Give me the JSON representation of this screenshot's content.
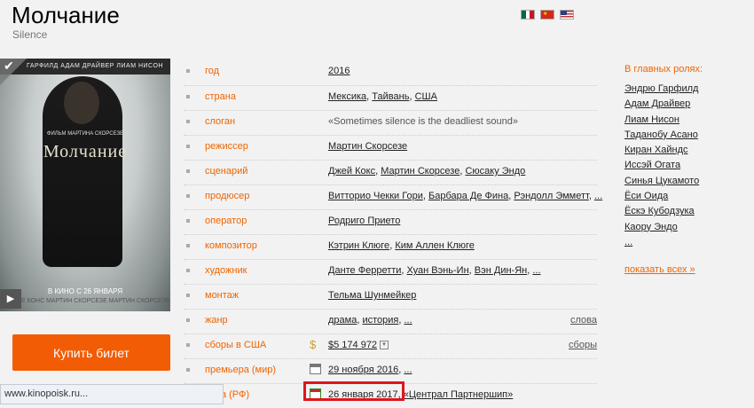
{
  "page": {
    "title": "Молчание",
    "original_title": "Silence"
  },
  "flags": [
    {
      "country": "Мексика",
      "colors": [
        "#006847",
        "#ffffff",
        "#ce1126"
      ]
    },
    {
      "country": "Тайвань",
      "colors": [
        "#d62918"
      ]
    },
    {
      "country": "США",
      "colors": [
        "#2c3e87",
        "#c0392b",
        "#ffffff"
      ]
    }
  ],
  "poster": {
    "top_text": "ГАРФИЛД   АДАМ ДРАЙВЕР   ЛИАМ НИСОН",
    "director_line": "ФИЛЬМ МАРТИНА СКОРСЕЗЕ",
    "movie_title": "Молчание",
    "release_line": "В КИНО С 26 ЯНВАРЯ",
    "credits_line": "НАЙКЛЕ КОНС  МАРТИН СКОРСЕЗЕ  МАРТИН СКОРСЕЗЕ"
  },
  "buy_ticket_label": "Купить билет",
  "status_bar": "www.kinopoisk.ru...",
  "info": {
    "year": {
      "label": "год",
      "value": "2016"
    },
    "country": {
      "label": "страна",
      "values": [
        "Мексика",
        "Тайвань",
        "США"
      ]
    },
    "slogan": {
      "label": "слоган",
      "value": "«Sometimes silence is the deadliest sound»"
    },
    "director": {
      "label": "режиссер",
      "value": "Мартин Скорсезе"
    },
    "writer": {
      "label": "сценарий",
      "values": [
        "Джей Кокс",
        "Мартин Скорсезе",
        "Сюсаку Эндо"
      ]
    },
    "producer": {
      "label": "продюсер",
      "values": [
        "Витторио Чекки Гори",
        "Барбара Де Фина",
        "Рэндолл Эмметт"
      ],
      "more": "..."
    },
    "operator": {
      "label": "оператор",
      "value": "Родриго Прието"
    },
    "composer": {
      "label": "композитор",
      "values": [
        "Кэтрин Клюге",
        "Ким Аллен Клюге"
      ]
    },
    "artist": {
      "label": "художник",
      "values": [
        "Данте Ферретти",
        "Хуан Вэнь-Ин",
        "Вэн Дин-Ян"
      ],
      "more": "..."
    },
    "editing": {
      "label": "монтаж",
      "value": "Тельма Шунмейкер"
    },
    "genre": {
      "label": "жанр",
      "values": [
        "драма",
        "история"
      ],
      "more": "...",
      "right_link": "слова"
    },
    "box_office_us": {
      "label": "сборы в США",
      "value": "$5 174 972",
      "right_link": "сборы"
    },
    "premiere_world": {
      "label": "премьера (мир)",
      "value": "29 ноября 2016",
      "more": "..."
    },
    "premiere_rf": {
      "label": "премьера (РФ)",
      "label_visible": "ьера (РФ)",
      "value": "26 января 2017",
      "distributor": "«Централ Партнершип»"
    }
  },
  "cast": {
    "heading": "В главных ролях:",
    "actors": [
      "Эндрю Гарфилд",
      "Адам Драйвер",
      "Лиам Нисон",
      "Таданобу Асано",
      "Киран Хайндс",
      "Иссэй Огата",
      "Синья Цукамото",
      "Ёси Оида",
      "Ёскэ Кубодзука",
      "Каору Эндо",
      "..."
    ],
    "show_all": "показать всех »"
  }
}
